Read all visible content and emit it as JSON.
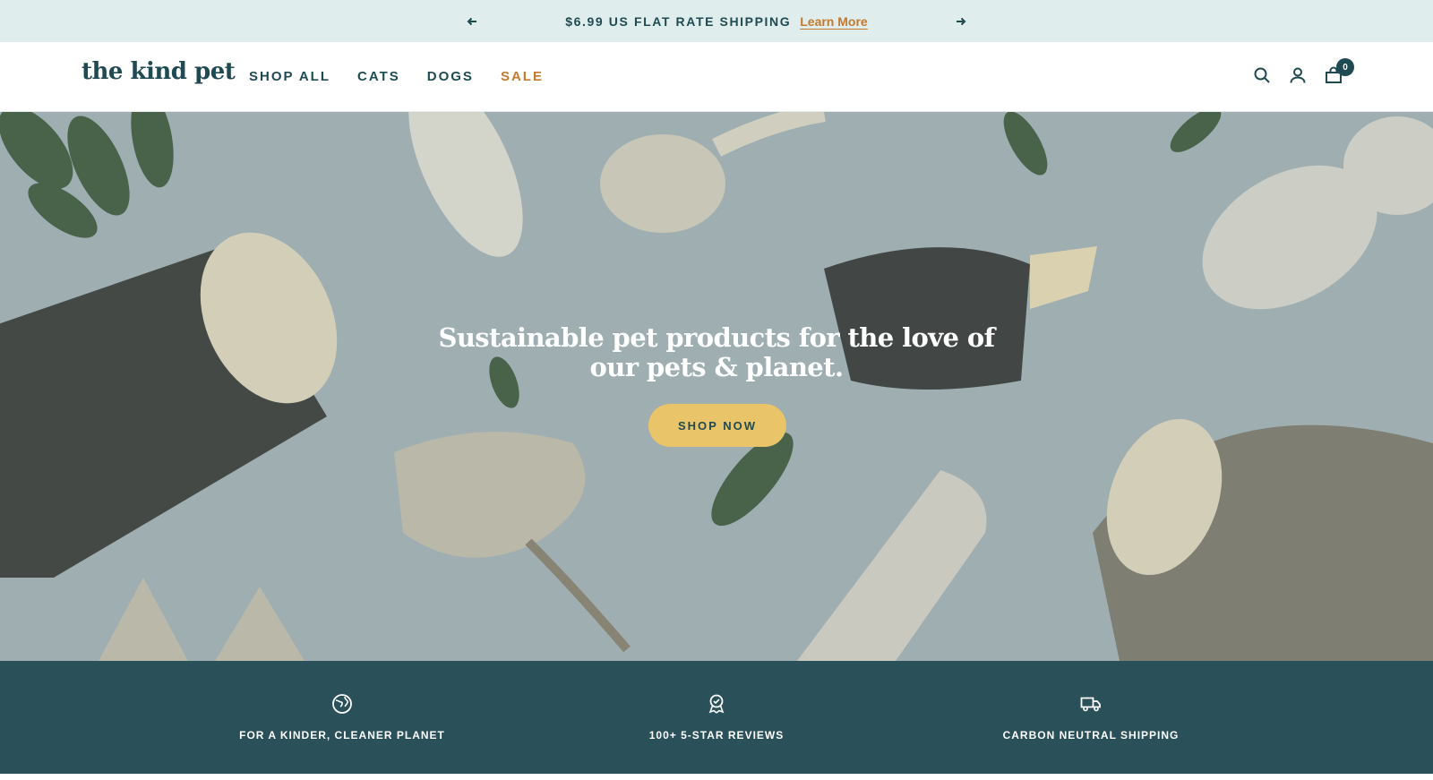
{
  "announcement": {
    "prev_icon": "arrow-left-icon",
    "message": "$6.99 US FLAT RATE SHIPPING",
    "link_label": "Learn More",
    "next_icon": "arrow-right-icon"
  },
  "header": {
    "logo": "the kind pet",
    "nav": [
      {
        "label": "SHOP ALL"
      },
      {
        "label": "CATS"
      },
      {
        "label": "DOGS"
      },
      {
        "label": "SALE"
      }
    ],
    "icons": [
      "search-icon",
      "account-icon",
      "cart-icon"
    ],
    "cart_count": "0"
  },
  "hero": {
    "title": "Sustainable pet products for the love of our pets & planet.",
    "button_label": "SHOP NOW"
  },
  "features": [
    {
      "icon": "globe-icon",
      "label": "FOR A KINDER, CLEANER PLANET"
    },
    {
      "icon": "award-ribbon-icon",
      "label": "100+ 5-STAR REVIEWS"
    },
    {
      "icon": "truck-icon",
      "label": "CARBON NEUTRAL SHIPPING"
    }
  ],
  "colors": {
    "brand": "#1f4a52",
    "accent": "#c47a2c",
    "button": "#e9c468",
    "announce_bg": "#e0eded",
    "features_bg": "#2a505a"
  }
}
